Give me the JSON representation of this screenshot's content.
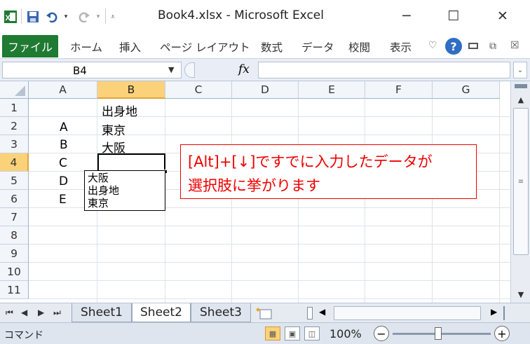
{
  "window": {
    "title": "Book4.xlsx - Microsoft Excel",
    "minimize": "─",
    "maximize": "☐",
    "close": "✕"
  },
  "quick_access": {
    "save_icon": "save-icon",
    "undo_icon": "undo-icon",
    "redo_icon": "redo-icon",
    "customize_icon": "customize-icon"
  },
  "ribbon": {
    "file_tab": "ファイル",
    "tabs": [
      "ホーム",
      "挿入",
      "ページ レイアウト",
      "数式",
      "データ",
      "校閲",
      "表示"
    ]
  },
  "formula_bar": {
    "name_box": "B4",
    "fx_label": "fx",
    "formula": ""
  },
  "columns": [
    "A",
    "B",
    "C",
    "D",
    "E",
    "F",
    "G"
  ],
  "rows": [
    "1",
    "2",
    "3",
    "4",
    "5",
    "6",
    "7",
    "8",
    "9",
    "10",
    "11"
  ],
  "selected_cell": "B4",
  "cells": {
    "B1": "出身地",
    "A2": "A",
    "B2": "東京",
    "A3": "B",
    "B3": "大阪",
    "A4": "C",
    "A5": "D",
    "A6": "E"
  },
  "dropdown_list": {
    "items": [
      "大阪",
      "出身地",
      "東京"
    ]
  },
  "callout": {
    "line1": "[Alt]+[↓]ですでに入力したデータが",
    "line2": "選択肢に挙がります"
  },
  "sheets": {
    "tabs": [
      "Sheet1",
      "Sheet2",
      "Sheet3"
    ],
    "active": "Sheet2"
  },
  "status_bar": {
    "mode": "コマンド",
    "zoom": "100%",
    "zoom_level": 1.0
  },
  "colors": {
    "file_tab": "#1f7a32",
    "selection_header": "#fbd27a",
    "callout": "#e00000"
  }
}
